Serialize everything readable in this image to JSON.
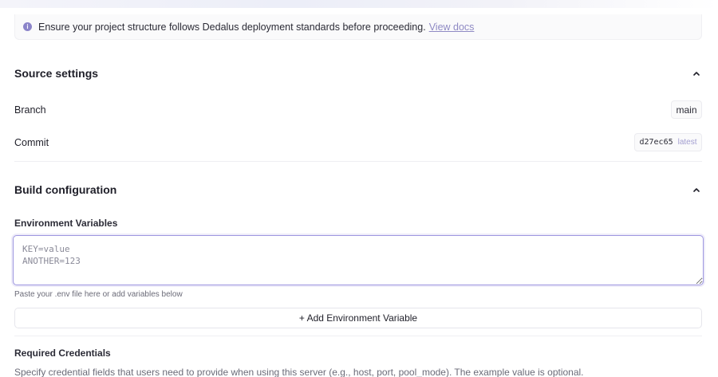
{
  "notice": {
    "icon": "info-icon",
    "text": "Ensure your project structure follows Dedalus deployment standards before proceeding.",
    "link_label": "View docs"
  },
  "source_settings": {
    "title": "Source settings",
    "branch_label": "Branch",
    "branch_value": "main",
    "commit_label": "Commit",
    "commit_hash": "d27ec65",
    "commit_tag": "latest"
  },
  "build_configuration": {
    "title": "Build configuration",
    "env_label": "Environment Variables",
    "env_value": "",
    "env_placeholder": "KEY=value\nANOTHER=123",
    "env_helper": "Paste your .env file here or add variables below",
    "add_env_label": "+ Add Environment Variable",
    "credentials_label": "Required Credentials",
    "credentials_desc": "Specify credential fields that users need to provide when using this server (e.g., host, port, pool_mode). The example value is optional."
  },
  "colors": {
    "accent": "#9e97e0",
    "link": "#8f8ac4",
    "info_icon": "#8b84c9"
  }
}
